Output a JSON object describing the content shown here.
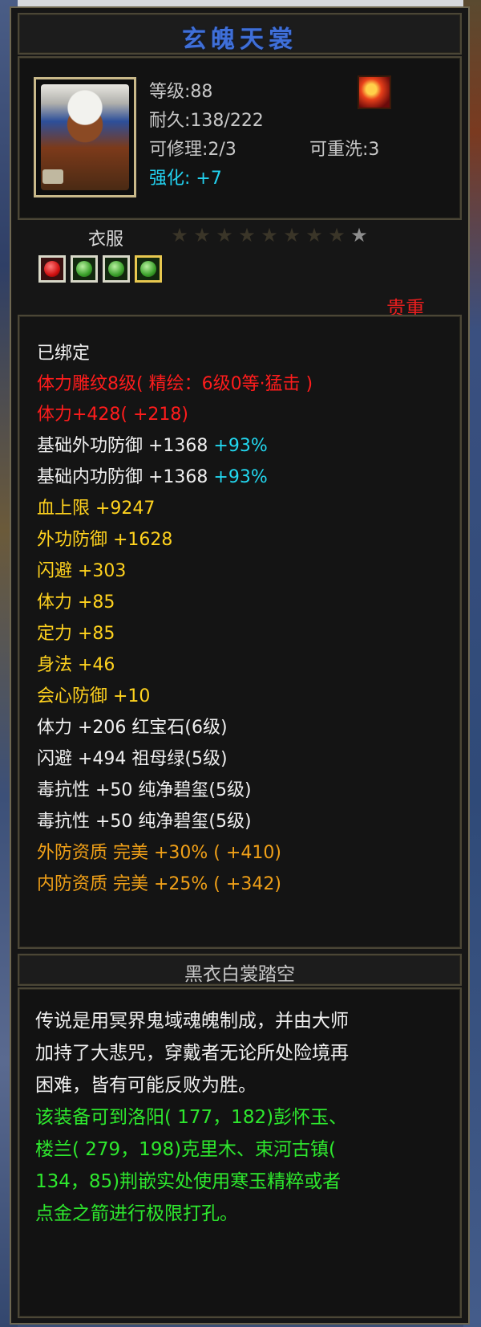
{
  "item": {
    "name": "玄魄天裳",
    "level": "等级:88",
    "durability": "耐久:138/222",
    "repairable": "可修理:2/3",
    "rewash": "可重洗:3",
    "enhance": "强化: +7",
    "type": "衣服",
    "stars_total": 9,
    "stars_lit": 1,
    "rarity": "贵重",
    "rarity_color": "#e81e1e",
    "icon": "armor-robe-icon",
    "badge_icon": "flame-badge-icon",
    "gems": [
      "red-gem-icon",
      "green-gem-icon",
      "green-gem-icon",
      "green-gem-icon"
    ]
  },
  "attributes": {
    "bound": "已绑定",
    "engrave": "体力雕纹8级( 精绘：6级0等·猛击 )",
    "stamina_bonus": "体力+428( +218)",
    "base_outer_def": "基础外功防御 +1368",
    "base_outer_def_pct": "+93%",
    "base_inner_def": "基础内功防御 +1368",
    "base_inner_def_pct": "+93%",
    "hp": "血上限  +9247",
    "outer_def": "外功防御  +1628",
    "dodge": "闪避  +303",
    "stamina": "体力  +85",
    "focus": "定力  +85",
    "agility": "身法  +46",
    "crit_def": "会心防御  +10",
    "gem_stamina": "体力  +206  红宝石(6级)",
    "gem_dodge": "闪避  +494  祖母绿(5级)",
    "gem_poison_1": "毒抗性  +50  纯净碧玺(5级)",
    "gem_poison_2": "毒抗性  +50  纯净碧玺(5级)",
    "outer_quality": "外防资质    完美 +30% ( +410)",
    "inner_quality": "内防资质    完美 +25% ( +342)"
  },
  "set": {
    "name": "黑衣白裳踏空"
  },
  "description": {
    "lore": [
      "传说是用冥界鬼域魂魄制成，并由大师",
      "加持了大悲咒，穿戴者无论所处险境再",
      "困难，皆有可能反败为胜。"
    ],
    "hint": [
      "该装备可到洛阳( 177，182)彭怀玉、",
      "楼兰( 279，198)克里木、束河古镇(",
      "134，85)荆嵌实处使用寒玉精粹或者",
      "点金之箭进行极限打孔。"
    ]
  }
}
